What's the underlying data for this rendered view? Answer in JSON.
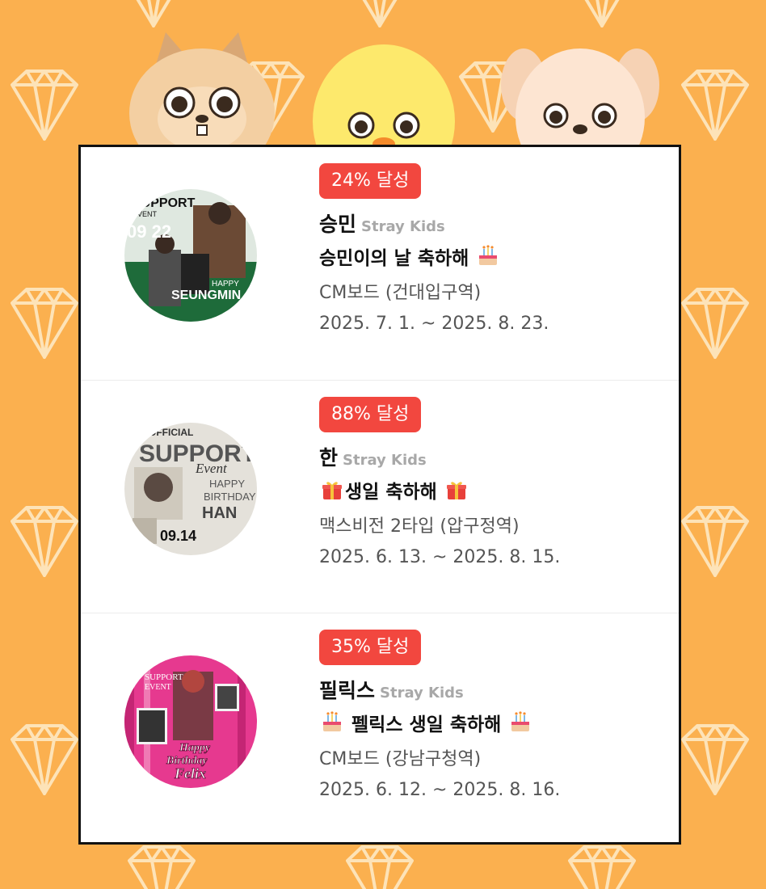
{
  "colors": {
    "background": "#fbb04f",
    "badge": "#f2473f",
    "card": "#ffffff",
    "group_text": "#a8a8a8"
  },
  "events": [
    {
      "badge": "24% 달성",
      "name": "승민",
      "group": "Stray Kids",
      "title_prefix": "",
      "title": "승민이의 날 축하해",
      "title_emoji": "birthday-cake",
      "place": "CM보드 (건대입구역)",
      "dates": "2025. 7. 1. ~ 2025. 8. 23.",
      "poster": {
        "text_top": "SUPPORT",
        "text_sub": "EVENT",
        "date": "09 22",
        "happy": "HAPPY",
        "member": "SEUNGMIN"
      }
    },
    {
      "badge": "88% 달성",
      "name": "한",
      "group": "Stray Kids",
      "title": "생일 축하해",
      "title_emoji": "gift",
      "place": "맥스비전 2타입 (압구정역)",
      "dates": "2025. 6. 13. ~ 2025. 8. 15.",
      "poster": {
        "text_top": "OFFICIAL",
        "text_main": "SUPPORT",
        "text_script": "Event",
        "happy": "HAPPY",
        "birthday": "BIRTHDAY",
        "member": "HAN",
        "date": "09.14"
      }
    },
    {
      "badge": "35% 달성",
      "name": "필릭스",
      "group": "Stray Kids",
      "title": "펠릭스 생일 축하해",
      "title_emoji": "birthday-cake",
      "place": "CM보드 (강남구청역)",
      "dates": "2025. 6. 12. ~ 2025. 8. 16.",
      "poster": {
        "text_top": "SUPPORT",
        "text_sub": "EVENT",
        "happy": "Happy",
        "birthday": "Birthday",
        "member": "Felix"
      }
    }
  ]
}
